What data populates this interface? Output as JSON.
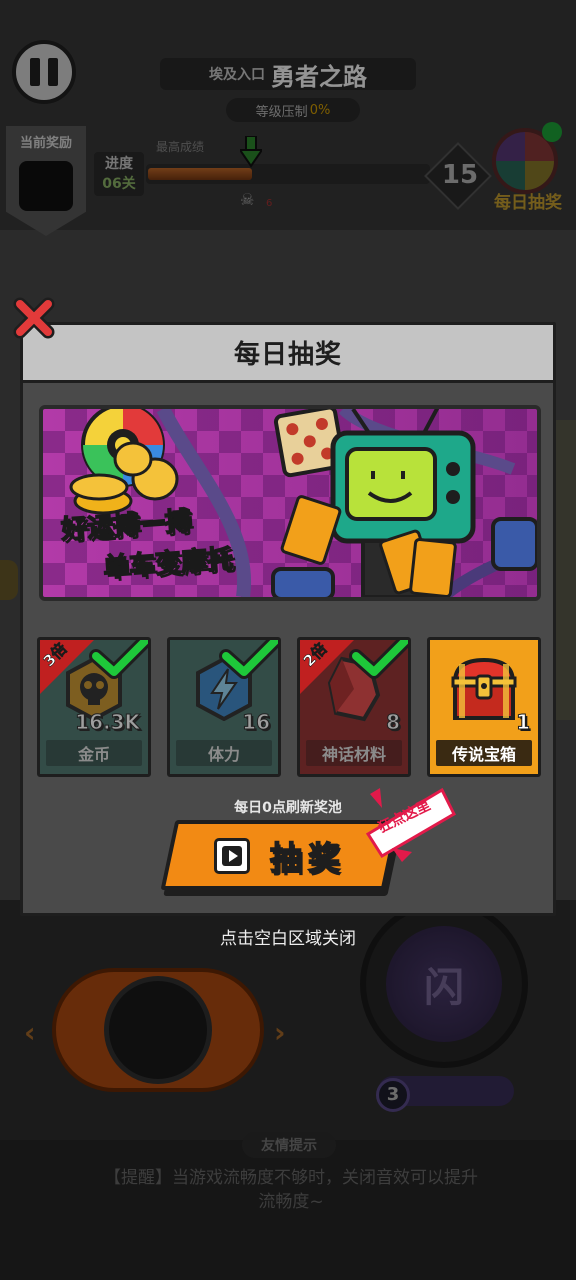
{
  "background": {
    "header": {
      "entrance_label": "埃及入口",
      "road_title": "勇者之路",
      "level_suppress_label": "等级压制",
      "level_suppress_value": "0%"
    },
    "current_reward_label": "当前奖励",
    "progress": {
      "label": "进度",
      "level_text": "06关",
      "best_label": "最高成绩",
      "fill_fraction": 0.37,
      "skull_count": "6",
      "stage_number": "15"
    },
    "daily_lottery_label": "每日抽奖",
    "flash_button_glyph": "闪",
    "skill_charge": "3",
    "tip_pill": "友情提示",
    "tip_text": "【提醒】当游戏流畅度不够时，关闭音效可以提升流畅度~"
  },
  "dialog": {
    "title": "每日抽奖",
    "banner": {
      "slogan_line1": "好运搏一搏",
      "slogan_line2": "单车变摩托"
    },
    "prizes": [
      {
        "name": "金币",
        "quantity": "16.3K",
        "multiplier": "3倍",
        "claimed": true,
        "icon": "skull-coin-icon"
      },
      {
        "name": "体力",
        "quantity": "16",
        "multiplier": "",
        "claimed": true,
        "icon": "lightning-badge-icon"
      },
      {
        "name": "神话材料",
        "quantity": "8",
        "multiplier": "2倍",
        "claimed": true,
        "icon": "red-crystal-icon"
      },
      {
        "name": "传说宝箱",
        "quantity": "1",
        "multiplier": "",
        "claimed": false,
        "icon": "treasure-chest-icon"
      }
    ],
    "refresh_note": "每日0点刷新奖池",
    "draw_button_label": "抽奖",
    "tap_hint": "狂点这里",
    "colors": {
      "accent_orange": "#f28a14",
      "check_green": "#1ec83a",
      "chest_gold": "#f2a01a",
      "myth_red": "#8a1e1e",
      "item_teal": "#3c6a62"
    }
  },
  "close_hint": "点击空白区域关闭"
}
